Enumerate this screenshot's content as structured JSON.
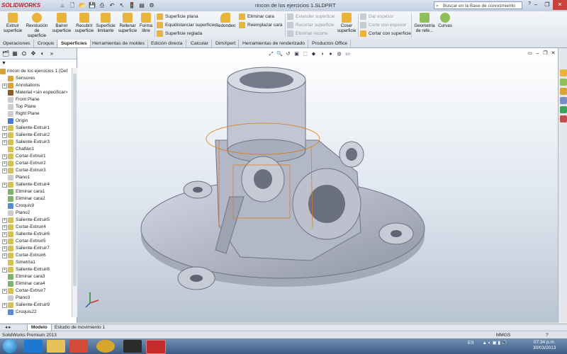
{
  "app": {
    "logo": "SOLIDWORKS",
    "window_title": "rincon de los ejercicios 1.SLDPRT",
    "search_placeholder": "Buscar en la Base de conocimiento",
    "help": "?"
  },
  "ribbon": {
    "big_buttons": [
      {
        "id": "extruir",
        "label": "Extruir superficie"
      },
      {
        "id": "revolucion",
        "label": "Revolución de superficie"
      },
      {
        "id": "barrer",
        "label": "Barrer superficie"
      },
      {
        "id": "recubrir",
        "label": "Recubrir superficie"
      },
      {
        "id": "limitante",
        "label": "Superficie limitante"
      },
      {
        "id": "rellenar",
        "label": "Rellenar superficie"
      },
      {
        "id": "formalibre",
        "label": "Forma libre"
      }
    ],
    "col1": [
      "Superficie plana",
      "Equidistanciar superficie",
      "Superficie reglada"
    ],
    "redondeo": "Redondeo",
    "col2": [
      "Eliminar cara",
      "Reemplazar cara"
    ],
    "col3": [
      "Extender superficie",
      "Recortar superficie",
      "Eliminar recorte"
    ],
    "coser": "Coser superficie",
    "col4": [
      "Dar espesor",
      "Corte con espesor",
      "Cortar con superficie"
    ],
    "geometria": "Geometría de refe...",
    "curvas": "Curvas"
  },
  "tabs": [
    "Operaciones",
    "Croquis",
    "Superficies",
    "Herramientas de moldes",
    "Edición directa",
    "Calcular",
    "DimXpert",
    "Herramientas de renderizado",
    "Productos Office"
  ],
  "tree": {
    "root": "rincon de los ejercicios 1  (Def",
    "items": [
      {
        "label": "Sensores",
        "exp": false,
        "icon": "#d9a33a"
      },
      {
        "label": "Annotations",
        "exp": true,
        "icon": "#d9a33a"
      },
      {
        "label": "Material <sin especificar>",
        "exp": false,
        "icon": "#8a5a2b"
      },
      {
        "label": "Front Plane",
        "exp": false,
        "icon": "#cccccc"
      },
      {
        "label": "Top Plane",
        "exp": false,
        "icon": "#cccccc"
      },
      {
        "label": "Right Plane",
        "exp": false,
        "icon": "#cccccc"
      },
      {
        "label": "Origin",
        "exp": false,
        "icon": "#4a7bd0"
      },
      {
        "label": "Saliente-Extruir1",
        "exp": true,
        "icon": "#d4c15a"
      },
      {
        "label": "Saliente-Extruir2",
        "exp": true,
        "icon": "#d4c15a"
      },
      {
        "label": "Saliente-Extruir3",
        "exp": true,
        "icon": "#d4c15a"
      },
      {
        "label": "Chaflán1",
        "exp": false,
        "icon": "#d4c15a"
      },
      {
        "label": "Cortar-Extruir1",
        "exp": true,
        "icon": "#d4c15a"
      },
      {
        "label": "Cortar-Extruir2",
        "exp": true,
        "icon": "#d4c15a"
      },
      {
        "label": "Cortar-Extruir3",
        "exp": true,
        "icon": "#d4c15a"
      },
      {
        "label": "Plano1",
        "exp": false,
        "icon": "#cccccc"
      },
      {
        "label": "Saliente-Extruir4",
        "exp": true,
        "icon": "#d4c15a"
      },
      {
        "label": "Eliminar cara1",
        "exp": false,
        "icon": "#7fb36a"
      },
      {
        "label": "Eliminar cara2",
        "exp": false,
        "icon": "#7fb36a"
      },
      {
        "label": "Croquis9",
        "exp": false,
        "icon": "#5a8ad0"
      },
      {
        "label": "Plano2",
        "exp": false,
        "icon": "#cccccc"
      },
      {
        "label": "Saliente-Extruir5",
        "exp": true,
        "icon": "#d4c15a"
      },
      {
        "label": "Cortar-Extruir4",
        "exp": true,
        "icon": "#d4c15a"
      },
      {
        "label": "Saliente-Extruir6",
        "exp": true,
        "icon": "#d4c15a"
      },
      {
        "label": "Cortar-Extruir5",
        "exp": true,
        "icon": "#d4c15a"
      },
      {
        "label": "Saliente-Extruir7",
        "exp": true,
        "icon": "#d4c15a"
      },
      {
        "label": "Cortar-Extruir6",
        "exp": true,
        "icon": "#d4c15a"
      },
      {
        "label": "Simetría1",
        "exp": false,
        "icon": "#d4c15a"
      },
      {
        "label": "Saliente-Extruir8",
        "exp": true,
        "icon": "#d4c15a"
      },
      {
        "label": "Eliminar cara3",
        "exp": false,
        "icon": "#7fb36a"
      },
      {
        "label": "Eliminar cara4",
        "exp": false,
        "icon": "#7fb36a"
      },
      {
        "label": "Cortar-Extruir7",
        "exp": true,
        "icon": "#d4c15a"
      },
      {
        "label": "Plano3",
        "exp": false,
        "icon": "#cccccc"
      },
      {
        "label": "Saliente-Extruir9",
        "exp": true,
        "icon": "#d4c15a"
      },
      {
        "label": "Croquis22",
        "exp": false,
        "icon": "#5a8ad0"
      }
    ]
  },
  "bottom_tabs": [
    "Modelo",
    "Estudio de movimiento 1"
  ],
  "status": {
    "left": "SolidWorks Premium 2013",
    "units": "MMGS",
    "help": "?"
  },
  "taskbar": {
    "lang": "ES",
    "time": "07:34 p.m.",
    "date": "30/03/2013"
  },
  "colors": {
    "accent": "#e07a10",
    "model": "#b7bccb"
  }
}
